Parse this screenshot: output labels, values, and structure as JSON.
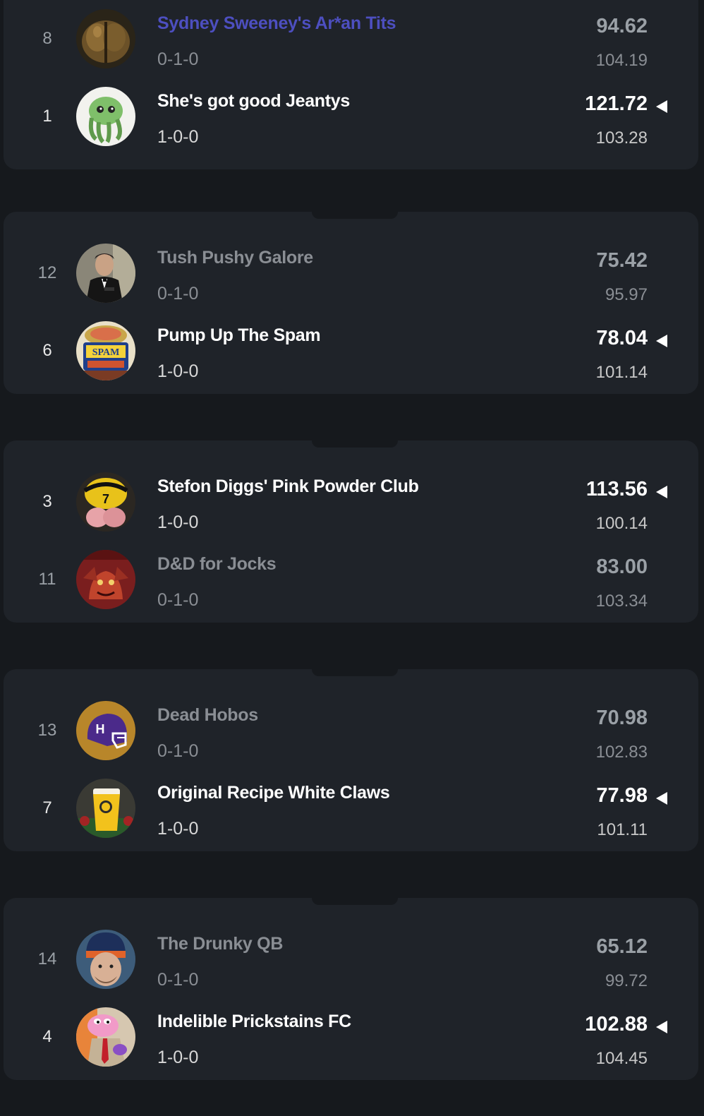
{
  "matchups": [
    {
      "teams": [
        {
          "rank": "8",
          "name": "Sydney Sweeney's Ar*an Tits",
          "record": "0-1-0",
          "score": "94.62",
          "projected": "104.19",
          "winner": false,
          "highlight": true,
          "avatar_icon": "bronze-helmet-avatar"
        },
        {
          "rank": "1",
          "name": "She's got good Jeantys",
          "record": "1-0-0",
          "score": "121.72",
          "projected": "103.28",
          "winner": true,
          "highlight": false,
          "avatar_icon": "green-tentacle-creature-avatar"
        }
      ]
    },
    {
      "teams": [
        {
          "rank": "12",
          "name": "Tush Pushy Galore",
          "record": "0-1-0",
          "score": "75.42",
          "projected": "95.97",
          "winner": false,
          "highlight": false,
          "avatar_icon": "man-in-tuxedo-avatar"
        },
        {
          "rank": "6",
          "name": "Pump Up The Spam",
          "record": "1-0-0",
          "score": "78.04",
          "projected": "101.14",
          "winner": true,
          "highlight": false,
          "avatar_icon": "spam-can-avatar",
          "avatar_text": "SPAM"
        }
      ]
    },
    {
      "teams": [
        {
          "rank": "3",
          "name": "Stefon Diggs' Pink Powder Club",
          "record": "1-0-0",
          "score": "113.56",
          "projected": "100.14",
          "winner": true,
          "highlight": false,
          "avatar_icon": "yellow-jersey-7-avatar",
          "avatar_text": "7"
        },
        {
          "rank": "11",
          "name": "D&D for Jocks",
          "record": "0-1-0",
          "score": "83.00",
          "projected": "103.34",
          "winner": false,
          "highlight": false,
          "avatar_icon": "red-dragon-avatar"
        }
      ]
    },
    {
      "teams": [
        {
          "rank": "13",
          "name": "Dead Hobos",
          "record": "0-1-0",
          "score": "70.98",
          "projected": "102.83",
          "winner": false,
          "highlight": false,
          "avatar_icon": "purple-helmet-avatar",
          "avatar_text": "H"
        },
        {
          "rank": "7",
          "name": "Original Recipe White Claws",
          "record": "1-0-0",
          "score": "77.98",
          "projected": "101.11",
          "winner": true,
          "highlight": false,
          "avatar_icon": "yellow-cup-avatar"
        }
      ]
    },
    {
      "teams": [
        {
          "rank": "14",
          "name": "The Drunky QB",
          "record": "0-1-0",
          "score": "65.12",
          "projected": "99.72",
          "winner": false,
          "highlight": false,
          "avatar_icon": "man-in-beanie-avatar"
        },
        {
          "rank": "4",
          "name": "Indelible Prickstains FC",
          "record": "1-0-0",
          "score": "102.88",
          "projected": "104.45",
          "winner": true,
          "highlight": false,
          "avatar_icon": "pink-hippo-cartoon-avatar"
        }
      ]
    }
  ],
  "colors": {
    "page_bg": "#16191d",
    "card_bg": "#1f2329",
    "winner_text": "#ffffff",
    "loser_text": "#8a8e94",
    "highlight_name": "#4d4fc0"
  }
}
